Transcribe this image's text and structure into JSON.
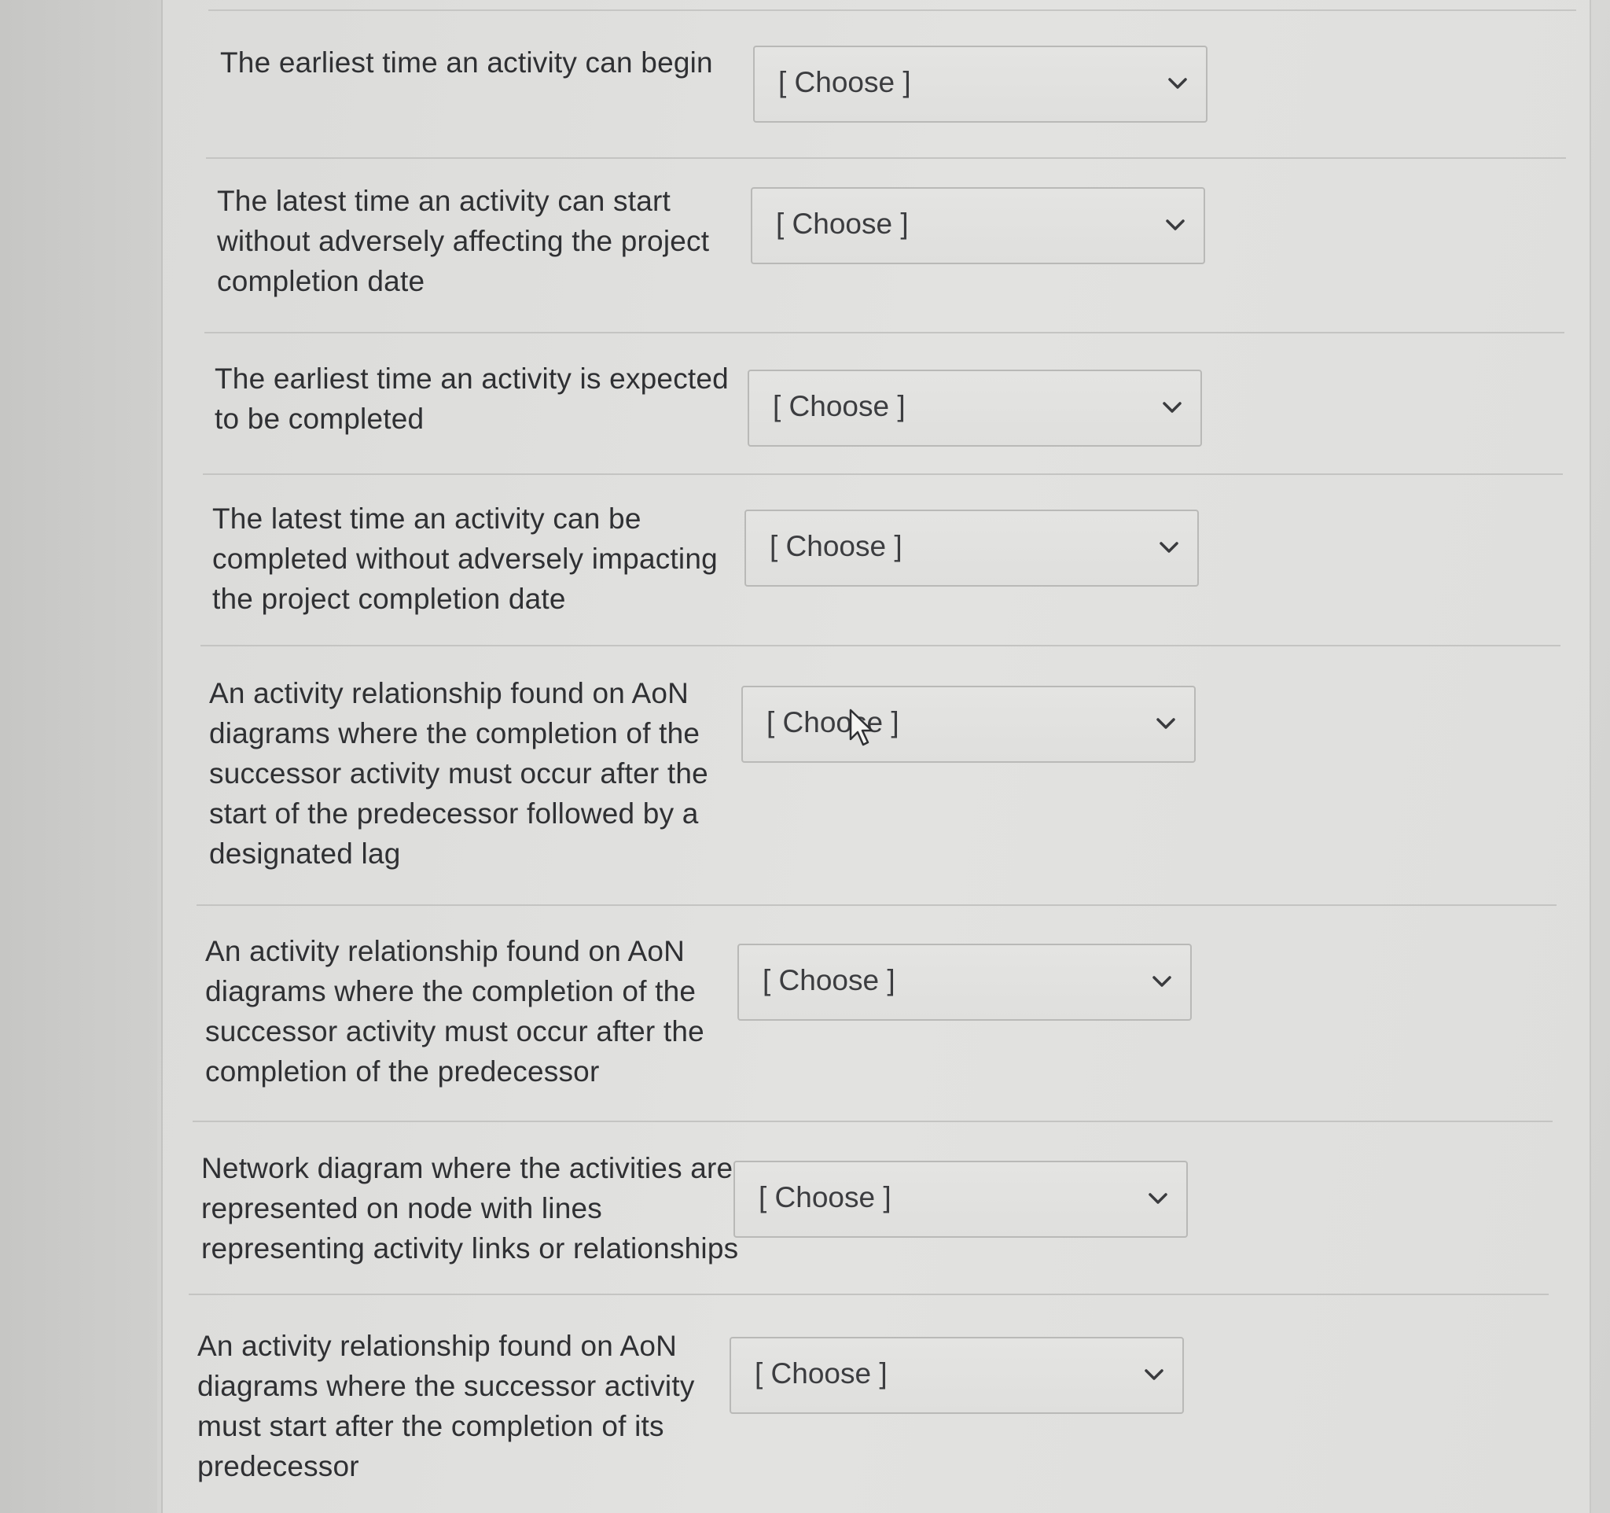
{
  "questions": [
    {
      "prompt": "The earliest time an activity can begin",
      "select": {
        "value": "[ Choose ]"
      }
    },
    {
      "prompt": "The latest time an activity can start\nwithout adversely affecting the project\ncompletion date",
      "select": {
        "value": "[ Choose ]"
      }
    },
    {
      "prompt": "The earliest time an activity is expected\nto be completed",
      "select": {
        "value": "[ Choose ]"
      }
    },
    {
      "prompt": "The latest time an activity can be\ncompleted without adversely impacting\nthe project completion date",
      "select": {
        "value": "[ Choose ]"
      }
    },
    {
      "prompt": "An activity relationship found on AoN\ndiagrams where the completion of the\nsuccessor activity must occur after the\nstart of the predecessor followed by a\ndesignated lag",
      "select": {
        "value": "[ Choose ]"
      }
    },
    {
      "prompt": "An activity relationship found on AoN\ndiagrams where the completion of the\nsuccessor activity must occur after the\ncompletion of the predecessor",
      "select": {
        "value": "[ Choose ]"
      }
    },
    {
      "prompt": "Network diagram where the activities are\nrepresented on node with lines\nrepresenting activity links or relationships",
      "select": {
        "value": "[ Choose ]"
      }
    },
    {
      "prompt": "An activity relationship found on AoN\ndiagrams where the successor activity\nmust start after the completion of its\npredecessor",
      "select": {
        "value": "[ Choose ]"
      }
    }
  ],
  "icons": {
    "dropdown": "chevron-down-icon",
    "pointer": "mouse-pointer-icon"
  },
  "colors": {
    "text": "#2f3033",
    "select_border": "#b9b9b7",
    "divider": "#c4c4c2"
  }
}
